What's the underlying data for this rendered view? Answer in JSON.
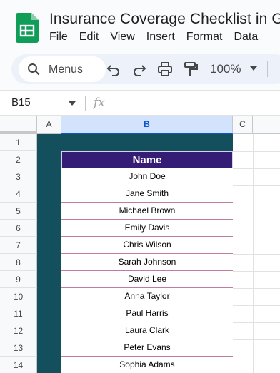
{
  "app": {
    "doc_title": "Insurance Coverage Checklist in Go",
    "menus": [
      "File",
      "Edit",
      "View",
      "Insert",
      "Format",
      "Data"
    ]
  },
  "toolbar": {
    "search_label": "Menus",
    "zoom": "100%"
  },
  "formula_bar": {
    "cell_ref": "B15",
    "fx_label": "fx"
  },
  "grid": {
    "columns": [
      "A",
      "B",
      "C"
    ],
    "selected_column": "B",
    "rows": [
      "1",
      "2",
      "3",
      "4",
      "5",
      "6",
      "7",
      "8",
      "9",
      "10",
      "11",
      "12",
      "13",
      "14"
    ]
  },
  "table": {
    "header": "Name",
    "names": [
      "John Doe",
      "Jane Smith",
      "Michael Brown",
      "Emily Davis",
      "Chris Wilson",
      "Sarah Johnson",
      "David Lee",
      "Anna Taylor",
      "Paul Harris",
      "Laura Clark",
      "Peter Evans",
      "Sophia Adams"
    ]
  },
  "colors": {
    "background_fill": "#134f5c",
    "header_fill": "#351c75",
    "row_border": "#c27ba0",
    "selected_header": "#d3e3fd"
  }
}
